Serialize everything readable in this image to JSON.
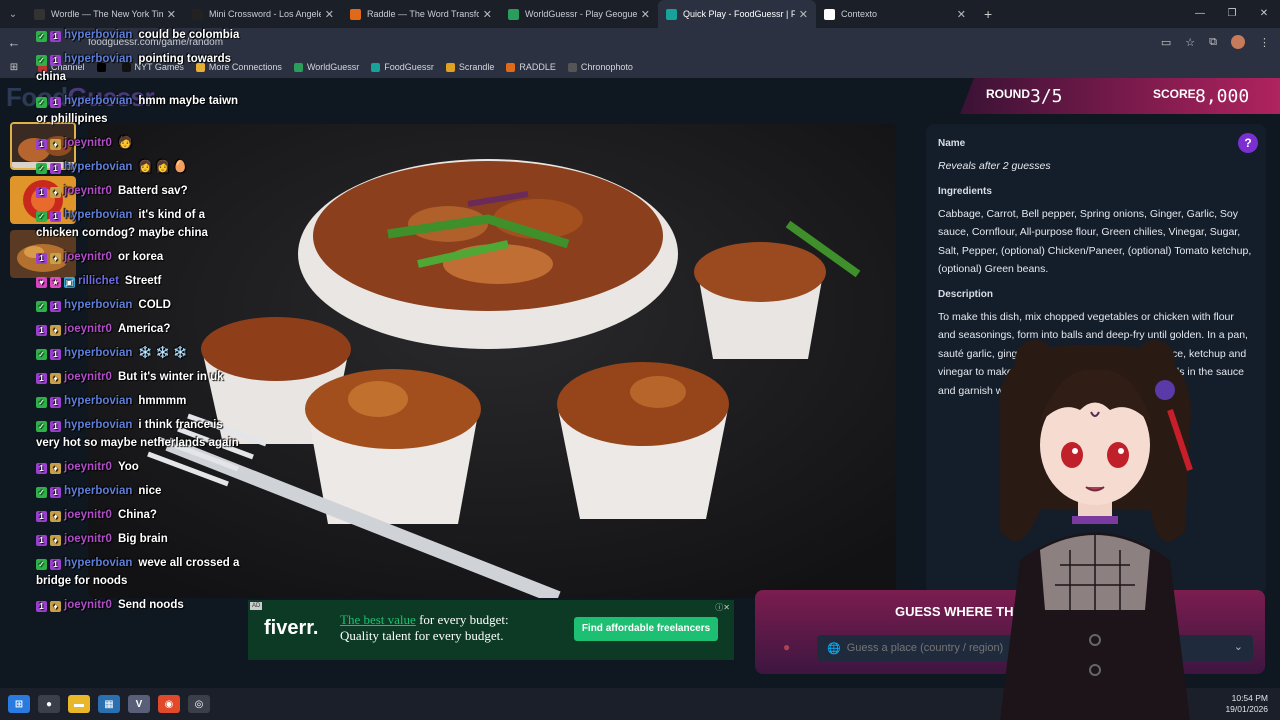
{
  "browser": {
    "tabs": [
      {
        "title": "Wordle — The New York Times",
        "icon": "nyt-icon",
        "color": "#333333",
        "active": false
      },
      {
        "title": "Mini Crossword - Los Angeles Times",
        "icon": "lat-icon",
        "color": "#222222",
        "active": false
      },
      {
        "title": "Raddle — The Word Transformation",
        "icon": "raddle-icon",
        "color": "#e06a1a",
        "active": false
      },
      {
        "title": "WorldGuessr - Play Geoguessr",
        "icon": "worldguessr-icon",
        "color": "#2a9d5c",
        "active": false
      },
      {
        "title": "Quick Play - FoodGuessr | Food",
        "icon": "foodguessr-icon",
        "color": "#18a39a",
        "active": true
      },
      {
        "title": "Contexto",
        "icon": "contexto-icon",
        "color": "#ffffff",
        "active": false
      }
    ],
    "url": "foodguessr.com/game/random",
    "bookmarks": [
      {
        "label": "Channel",
        "color": "#b33"
      },
      {
        "label": "",
        "color": "#000"
      },
      {
        "label": "NYT Games",
        "color": "#111"
      },
      {
        "label": "More Connections",
        "color": "#e6b035"
      },
      {
        "label": "WorldGuessr",
        "color": "#2a9d5c"
      },
      {
        "label": "FoodGuessr",
        "color": "#18a39a"
      },
      {
        "label": "Scrandle",
        "color": "#e0a020"
      },
      {
        "label": "RADDLE",
        "color": "#e06a1a"
      },
      {
        "label": "Chronophoto",
        "color": "#555"
      }
    ]
  },
  "game": {
    "logo_left": "Food",
    "logo_right": "Guessr",
    "round_label": "ROUND",
    "round_value": "3/5",
    "score_label": "SCORE",
    "score_value": "8,000",
    "help": "?",
    "name_heading": "Name",
    "name_value": "Reveals after 2 guesses",
    "ingredients_heading": "Ingredients",
    "ingredients": "Cabbage, Carrot, Bell pepper, Spring onions, Ginger, Garlic, Soy sauce, Cornflour, All-purpose flour, Green chilies, Vinegar, Sugar, Salt, Pepper, (optional) Chicken/Paneer, (optional) Tomato ketchup, (optional) Green beans.",
    "description_heading": "Description",
    "description": "To make this dish, mix chopped vegetables or chicken with flour and seasonings, form into balls and deep-fry until golden. In a pan, sauté garlic, ginger and green chilies. Add soy sauce, ketchup and vinegar to make a slurry. Stir well. Toss the fried balls in the sauce and garnish with chopped greens.",
    "guess_title": "GUESS WHERE THIS DISH IS FROM",
    "guess_placeholder": "Guess a place (country / region)"
  },
  "ad": {
    "tag": "AD",
    "logo": "fiverr.",
    "headline_hl": "The best value",
    "headline_rest": " for every budget:",
    "line2": "Quality talent for every budget.",
    "cta": "Find affordable freelancers"
  },
  "chat": [
    {
      "user": "hyperbovian",
      "badges": [
        "check",
        "one"
      ],
      "text": "could be colombia"
    },
    {
      "user": "hyperbovian",
      "badges": [
        "check",
        "one"
      ],
      "text": "pointing towards china"
    },
    {
      "user": "hyperbovian",
      "badges": [
        "check",
        "one"
      ],
      "text": "hmm maybe taiwn or phillipines"
    },
    {
      "user": "joeynitr0",
      "badges": [
        "one",
        "sub"
      ],
      "text": "🧑"
    },
    {
      "user": "hyperbovian",
      "badges": [
        "check",
        "one"
      ],
      "text": "👩 👩 🥚"
    },
    {
      "user": "joeynitr0",
      "badges": [
        "one",
        "sub"
      ],
      "text": "Batterd sav?"
    },
    {
      "user": "hyperbovian",
      "badges": [
        "check",
        "one"
      ],
      "text": "it's kind of a chicken corndog? maybe china"
    },
    {
      "user": "joeynitr0",
      "badges": [
        "one",
        "sub"
      ],
      "text": "or korea"
    },
    {
      "user": "rillichet",
      "badges": [
        "gem",
        "star",
        "box"
      ],
      "text": "Streetf"
    },
    {
      "user": "hyperbovian",
      "badges": [
        "check",
        "one"
      ],
      "text": "COLD"
    },
    {
      "user": "joeynitr0",
      "badges": [
        "one",
        "sub"
      ],
      "text": "America?"
    },
    {
      "user": "hyperbovian",
      "badges": [
        "check",
        "one"
      ],
      "text": "❄️ ❄️ ❄️"
    },
    {
      "user": "joeynitr0",
      "badges": [
        "one",
        "sub"
      ],
      "text": "But it's winter in uk"
    },
    {
      "user": "hyperbovian",
      "badges": [
        "check",
        "one"
      ],
      "text": "hmmmm"
    },
    {
      "user": "hyperbovian",
      "badges": [
        "check",
        "one"
      ],
      "text": "i think france is very hot so maybe netherlands again"
    },
    {
      "user": "joeynitr0",
      "badges": [
        "one",
        "sub"
      ],
      "text": "Yoo"
    },
    {
      "user": "hyperbovian",
      "badges": [
        "check",
        "one"
      ],
      "text": "nice"
    },
    {
      "user": "joeynitr0",
      "badges": [
        "one",
        "sub"
      ],
      "text": "China?"
    },
    {
      "user": "joeynitr0",
      "badges": [
        "one",
        "sub"
      ],
      "text": "Big brain"
    },
    {
      "user": "hyperbovian",
      "badges": [
        "check",
        "one"
      ],
      "text": "weve all crossed a bridge for noods"
    },
    {
      "user": "joeynitr0",
      "badges": [
        "one",
        "sub"
      ],
      "text": "Send noods"
    }
  ],
  "taskbar": {
    "time": "10:54 PM",
    "date": "19/01/2026"
  }
}
